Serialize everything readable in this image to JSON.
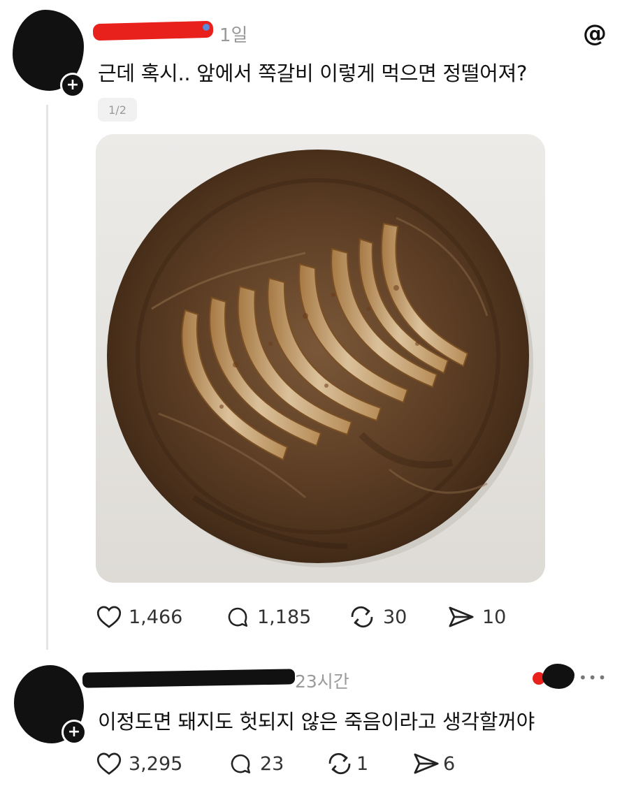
{
  "post": {
    "timestamp": "1일",
    "text": "근데 혹시.. 앞에서 쪽갈비 이렇게 먹으면 정떨어져?",
    "page_indicator": "1/2",
    "image_alt": "Round wooden plate with a row of grilled pork rib bones",
    "actions": {
      "likes": "1,466",
      "comments": "1,185",
      "reposts": "30",
      "shares": "10"
    }
  },
  "reply": {
    "timestamp": "23시간",
    "text": "이정도면 돼지도 헛되지 않은 죽음이라고 생각할꺼야",
    "actions": {
      "likes": "3,295",
      "comments": "23",
      "reposts": "1",
      "shares": "6"
    }
  },
  "icons": {
    "like": "heart-icon",
    "comment": "comment-bubble-icon",
    "repost": "repost-icon",
    "share": "send-icon",
    "app": "threads-logo-icon",
    "more": "more-dots-icon"
  },
  "colors": {
    "redaction_red": "#e8211c",
    "redaction_black": "#111111",
    "muted_text": "#9a9a9a",
    "wood_plate": "#6b4a2e"
  }
}
